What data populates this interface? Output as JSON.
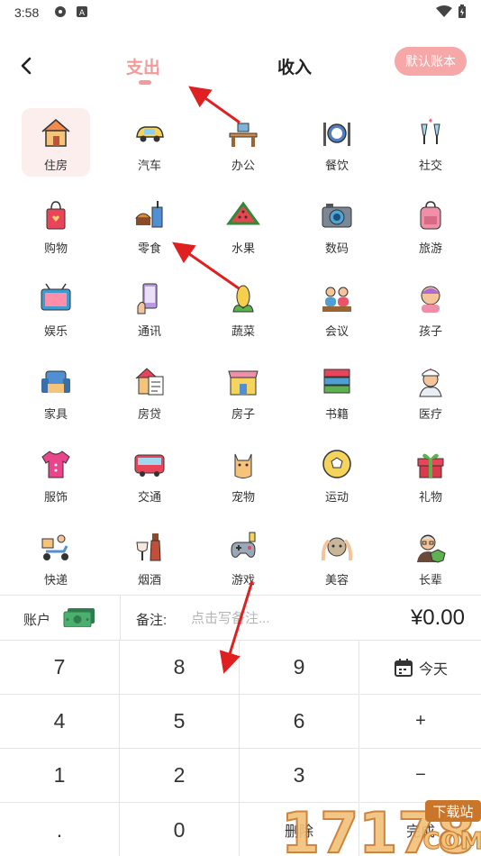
{
  "status": {
    "time": "3:58"
  },
  "header": {
    "tab_expense": "支出",
    "tab_income": "收入",
    "default_book": "默认账本"
  },
  "categories": [
    {
      "label": "住房",
      "icon": "house-icon"
    },
    {
      "label": "汽车",
      "icon": "car-icon"
    },
    {
      "label": "办公",
      "icon": "office-desk-icon"
    },
    {
      "label": "餐饮",
      "icon": "dining-icon"
    },
    {
      "label": "社交",
      "icon": "social-drinks-icon"
    },
    {
      "label": "购物",
      "icon": "shopping-bag-icon"
    },
    {
      "label": "零食",
      "icon": "snack-icon"
    },
    {
      "label": "水果",
      "icon": "watermelon-icon"
    },
    {
      "label": "数码",
      "icon": "camera-icon"
    },
    {
      "label": "旅游",
      "icon": "backpack-icon"
    },
    {
      "label": "娱乐",
      "icon": "tv-icon"
    },
    {
      "label": "通讯",
      "icon": "phone-icon"
    },
    {
      "label": "蔬菜",
      "icon": "corn-icon"
    },
    {
      "label": "会议",
      "icon": "meeting-icon"
    },
    {
      "label": "孩子",
      "icon": "child-icon"
    },
    {
      "label": "家具",
      "icon": "sofa-icon"
    },
    {
      "label": "房贷",
      "icon": "mortgage-icon"
    },
    {
      "label": "房子",
      "icon": "shop-house-icon"
    },
    {
      "label": "书籍",
      "icon": "books-icon"
    },
    {
      "label": "医疗",
      "icon": "nurse-icon"
    },
    {
      "label": "服饰",
      "icon": "shirt-icon"
    },
    {
      "label": "交通",
      "icon": "bus-icon"
    },
    {
      "label": "宠物",
      "icon": "cat-icon"
    },
    {
      "label": "运动",
      "icon": "soccer-ball-icon"
    },
    {
      "label": "礼物",
      "icon": "gift-icon"
    },
    {
      "label": "快递",
      "icon": "delivery-scooter-icon"
    },
    {
      "label": "烟酒",
      "icon": "tobacco-wine-icon"
    },
    {
      "label": "游戏",
      "icon": "gamepad-icon"
    },
    {
      "label": "美容",
      "icon": "facial-icon"
    },
    {
      "label": "长辈",
      "icon": "elder-icon"
    }
  ],
  "infobar": {
    "account_label": "账户",
    "note_label": "备注:",
    "note_placeholder": "点击写备注...",
    "amount": "¥0.00"
  },
  "keypad": {
    "k7": "7",
    "k8": "8",
    "k9": "9",
    "today": "今天",
    "k4": "4",
    "k5": "5",
    "k6": "6",
    "plus": "+",
    "k1": "1",
    "k2": "2",
    "k3": "3",
    "minus": "−",
    "dot": ".",
    "k0": "0",
    "delete": "删除",
    "done": "完成"
  },
  "watermark": {
    "text": "17178",
    "sub": "下载站",
    "domain": "COM"
  },
  "colors": {
    "accent": "#f59a9a",
    "selected_bg": "#fdeeee",
    "arrow": "#e02020"
  }
}
